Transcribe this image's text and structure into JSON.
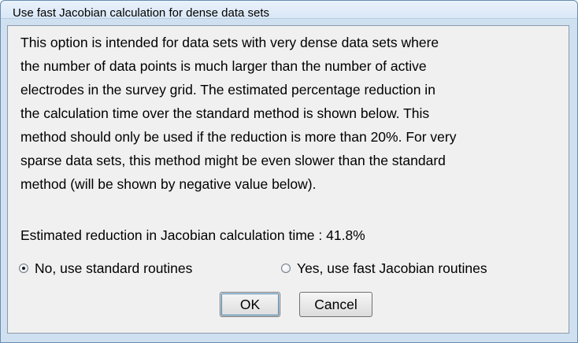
{
  "window": {
    "title": "Use fast Jacobian calculation for dense data sets"
  },
  "description": {
    "lines": [
      "This option is intended for data sets with very dense data sets where",
      "the number of data points is much larger than the number of active",
      "electrodes in the survey grid. The estimated percentage reduction in",
      "the calculation time over the standard method is shown below. This",
      "method should only be used if the reduction is more than 20%. For very",
      "sparse data sets, this method might be even slower than the standard",
      "method (will be shown by negative value below)."
    ]
  },
  "estimate": {
    "text": "Estimated reduction in Jacobian calculation time : 41.8%"
  },
  "options": [
    {
      "label": "No, use standard routines",
      "selected": true
    },
    {
      "label": "Yes, use fast Jacobian routines",
      "selected": false
    }
  ],
  "buttons": {
    "ok": "OK",
    "cancel": "Cancel"
  }
}
